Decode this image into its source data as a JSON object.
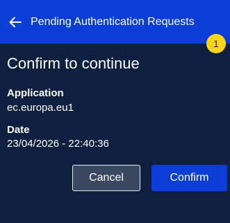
{
  "app_bar": {
    "back_icon": "arrow-left-icon",
    "title": "Pending Authentication Requests"
  },
  "main": {
    "heading": "Confirm to continue",
    "badge_count": "1",
    "fields": [
      {
        "label": "Application",
        "value": "ec.europa.eu1"
      },
      {
        "label": "Date",
        "value": "23/04/2026 - 22:40:36"
      }
    ]
  },
  "actions": {
    "cancel_label": "Cancel",
    "confirm_label": "Confirm"
  },
  "colors": {
    "background": "#0f1f40",
    "primary": "#0a3ed6",
    "badge": "#ffd617"
  }
}
